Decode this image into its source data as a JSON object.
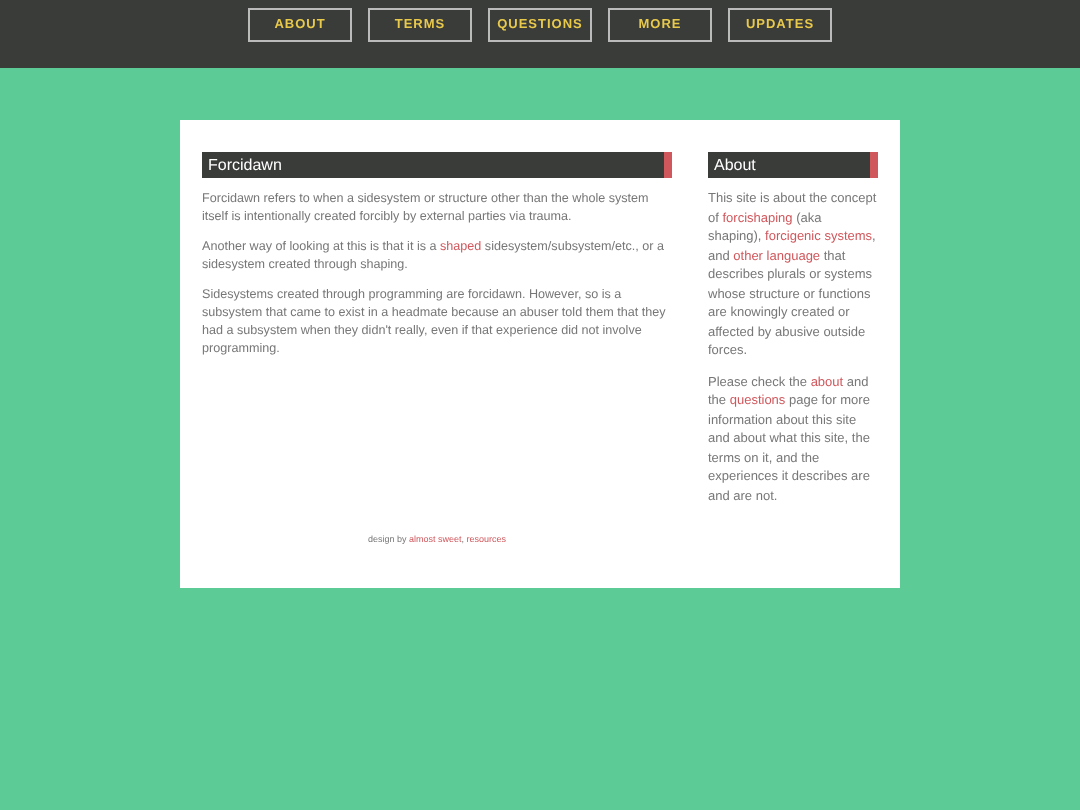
{
  "nav": [
    {
      "label": "ABOUT"
    },
    {
      "label": "TERMS"
    },
    {
      "label": "QUESTIONS"
    },
    {
      "label": "MORE"
    },
    {
      "label": "UPDATES"
    }
  ],
  "main": {
    "heading": "Forcidawn",
    "paragraphs": [
      [
        {
          "kind": "text",
          "text": "Forcidawn refers to when a sidesystem or structure other than the whole system itself is intentionally created forcibly by external parties via trauma."
        }
      ],
      [
        {
          "kind": "text",
          "text": "Another way of looking at this is that it is a "
        },
        {
          "kind": "link",
          "text": "shaped"
        },
        {
          "kind": "text",
          "text": " sidesystem/subsystem/etc., or a sidesystem created through shaping."
        }
      ],
      [
        {
          "kind": "text",
          "text": "Sidesystems created through programming are forcidawn. However, so is a subsystem that came to exist in a headmate because an abuser told them that they had a subsystem when they didn't really, even if that experience did not involve programming."
        }
      ]
    ]
  },
  "footer": [
    {
      "kind": "text",
      "text": "design by "
    },
    {
      "kind": "link",
      "text": "almost sweet"
    },
    {
      "kind": "text",
      "text": ", "
    },
    {
      "kind": "link",
      "text": "resources"
    }
  ],
  "sidebar": {
    "heading": "About",
    "paragraphs": [
      [
        {
          "kind": "text",
          "text": "This site is about the concept of "
        },
        {
          "kind": "link",
          "text": "forcishaping"
        },
        {
          "kind": "text",
          "text": " (aka shaping), "
        },
        {
          "kind": "link",
          "text": "forcigenic"
        },
        {
          "kind": "link",
          "text": "systems"
        },
        {
          "kind": "text",
          "text": ", and "
        },
        {
          "kind": "link",
          "text": "other"
        },
        {
          "kind": "link",
          "text": "language"
        },
        {
          "kind": "text",
          "text": " that describes plurals or systems whose structure or functions are knowingly created or affected by abusive outside forces."
        }
      ],
      [
        {
          "kind": "text",
          "text": "Please check the "
        },
        {
          "kind": "link",
          "text": "about"
        },
        {
          "kind": "text",
          "text": " and the "
        },
        {
          "kind": "link",
          "text": "questions"
        },
        {
          "kind": "text",
          "text": " page for more information about this site and about what this site, the terms on it, and the experiences it describes are and are not."
        }
      ]
    ]
  }
}
